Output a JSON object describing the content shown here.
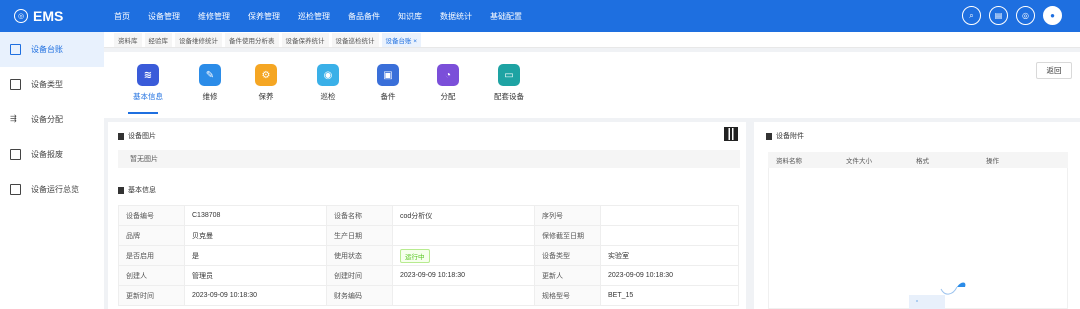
{
  "app": {
    "name": "EMS"
  },
  "nav": [
    "首页",
    "设备管理",
    "维修管理",
    "保养管理",
    "巡检管理",
    "备品备件",
    "知识库",
    "数据统计",
    "基础配置"
  ],
  "sidebar": {
    "items": [
      {
        "label": "设备台账",
        "active": true
      },
      {
        "label": "设备类型"
      },
      {
        "label": "设备分配"
      },
      {
        "label": "设备报废"
      },
      {
        "label": "设备运行总览"
      }
    ]
  },
  "tabs": [
    {
      "label": "资料库"
    },
    {
      "label": "经验库"
    },
    {
      "label": "设备维修统计"
    },
    {
      "label": "备件使用分析表"
    },
    {
      "label": "设备保养统计"
    },
    {
      "label": "设备巡检统计"
    },
    {
      "label": "设备台账 ×",
      "active": true
    }
  ],
  "modules": [
    {
      "label": "基本信息",
      "color": "#3a5bd9",
      "icon": "layers-icon",
      "active": true
    },
    {
      "label": "维修",
      "color": "#2b8ce8",
      "icon": "wrench-icon"
    },
    {
      "label": "保养",
      "color": "#f5a623",
      "icon": "maintenance-icon"
    },
    {
      "label": "巡检",
      "color": "#3ab0e8",
      "icon": "inspect-icon"
    },
    {
      "label": "备件",
      "color": "#3a6fd9",
      "icon": "parts-icon"
    },
    {
      "label": "分配",
      "color": "#7b4fd9",
      "icon": "pie-icon"
    },
    {
      "label": "配套设备",
      "color": "#1ea3a3",
      "icon": "toolbox-icon"
    }
  ],
  "back_label": "返回",
  "image_section": {
    "title": "设备图片",
    "empty_text": "暂无图片"
  },
  "basic_section": {
    "title": "基本信息"
  },
  "info": {
    "device_no_k": "设备编号",
    "device_no": "C138708",
    "device_name_k": "设备名称",
    "device_name": "cod分析仪",
    "serial_k": "序列号",
    "serial": "",
    "brand_k": "品牌",
    "brand": "贝克曼",
    "prod_date_k": "生产日期",
    "prod_date": "",
    "warranty_k": "保修截至日期",
    "warranty": "",
    "enabled_k": "是否启用",
    "enabled": "是",
    "status_k": "使用状态",
    "status": "运行中",
    "type_k": "设备类型",
    "type": "实验室",
    "creator_k": "创建人",
    "creator": "管理员",
    "created_k": "创建时间",
    "created": "2023-09-09 10:18:30",
    "updater_k": "更新人",
    "updated_by": "2023-09-09 10:18:30",
    "update_time_k": "更新时间",
    "update_time": "2023-09-09 10:18:30",
    "finance_k": "财务编码",
    "finance": "",
    "model_k": "规格型号",
    "model": "BET_15"
  },
  "attachments": {
    "title": "设备附件",
    "columns": [
      "资料名称",
      "文件大小",
      "格式",
      "操作"
    ]
  }
}
